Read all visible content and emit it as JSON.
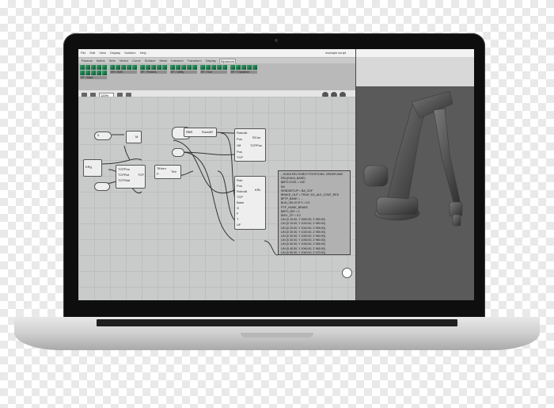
{
  "window": {
    "title": "example script",
    "menu": [
      "File",
      "Edit",
      "View",
      "Display",
      "Solution",
      "Help"
    ]
  },
  "tabs": [
    "Params",
    "Maths",
    "Sets",
    "Vector",
    "Curve",
    "Surface",
    "Mesh",
    "Intersect",
    "Transform",
    "Display",
    "Kiparoom"
  ],
  "ribbon_groups": [
    {
      "label": "RF / Base",
      "icon_count": 10
    },
    {
      "label": "KR / IK/IK",
      "icon_count": 5
    },
    {
      "label": "RF / Params",
      "icon_count": 5
    },
    {
      "label": "RF / Utility",
      "icon_count": 5
    },
    {
      "label": "RF / Tool",
      "icon_count": 5
    },
    {
      "label": "RF / Transform",
      "icon_count": 5
    }
  ],
  "toolbar": {
    "zoom": "120%"
  },
  "components": {
    "slider1": {
      "label": "0"
    },
    "comp_m": {
      "label": "M"
    },
    "comp_k": {
      "label": "KRg"
    },
    "comp_mid_inputs": [
      "TCPPos",
      "TCPRot",
      "TCPStat"
    ],
    "comp_tcp_label": "TCP",
    "comp_ttm_inputs": [
      "TiHorn",
      "P"
    ],
    "comp_ttm_out": "Ttm",
    "comp_top_left": "RBR",
    "comp_top_out": "RoutAR",
    "comp_big1_inputs": [
      "RobotA",
      "Pos",
      "Off",
      "Pos",
      "TCP"
    ],
    "comp_big1_outputs": [
      "RCon",
      "TCPPos"
    ],
    "comp_big2_inputs": [
      "Rob",
      "Pos",
      "RobotA",
      "TCP",
      "Base",
      "G",
      "F",
      "T",
      "UF"
    ],
    "comp_big2_outputs": [
      "KRL"
    ]
  },
  "panel_lines": [
    "...KUKA KRL ROBOT POSITIONS, ORDER AND ",
    "REL(KUKA_BASE)",
    "$APO.CVEL = 100",
    "INI",
    "SENDSETUP = BA_CDF",
    "BRAKE_OUT = TRUE, EG_ALE_CONT_RES",
    "$PTP_BASE = ...",
    "$LIN_VELOCITY = 0.5",
    "PTP_HOME_BRAKE",
    "$APO_DIS = 2",
    "$VEL_CP = 0.2",
    "LIN (X 10.00, Y 1000.00, Z 950.00)",
    "LIN {X 10.00, Y 1010.00, Z 950.00}",
    "LIN {X 20.00, Y 1010.00, Z 955.00}",
    "LIN {X 20.00, Y 1020.00, Z 955.00}",
    "LIN {X 30.00, Y 1020.00, Z 960.00}",
    "LIN {X 30.00, Y 1030.00, Z 960.00}",
    "LIN {X 40.00, Y 1030.00, Z 965.00}",
    "LIN {X 40.00, Y 1040.00, Z 965.00}",
    "LIN {X 50.00, Y 1040.00, Z 970.00}",
    "PTP_HOME_END",
    "END"
  ],
  "colors": {
    "accent": "#1c7a4c",
    "canvas": "#c9cbcb",
    "panel": "#b1b1b1"
  }
}
